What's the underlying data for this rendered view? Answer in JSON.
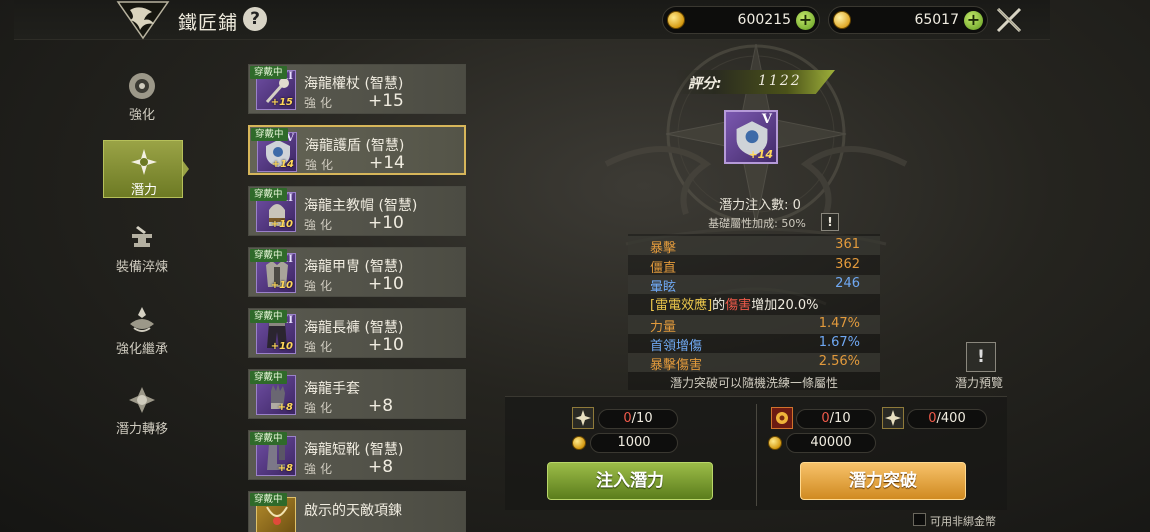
{
  "header": {
    "title": "鐵匠鋪",
    "help_label": "?",
    "currency_gold": "600215",
    "currency_diamond": "65017"
  },
  "nav": {
    "items": [
      {
        "label": "強化",
        "icon": "enhance-icon",
        "active": false
      },
      {
        "label": "潛力",
        "icon": "potential-icon",
        "active": true
      },
      {
        "label": "裝備淬煉",
        "icon": "anvil-icon",
        "active": false
      },
      {
        "label": "強化繼承",
        "icon": "inherit-icon",
        "active": false
      },
      {
        "label": "潛力轉移",
        "icon": "transfer-icon",
        "active": false
      }
    ]
  },
  "items": [
    {
      "badge": "穿戴中",
      "name": "海龍權杖 (智慧)",
      "sub": "強化",
      "value": "+15",
      "plus": "+15",
      "tier": "III"
    },
    {
      "badge": "穿戴中",
      "name": "海龍護盾 (智慧)",
      "sub": "強化",
      "value": "+14",
      "plus": "+14",
      "tier": "V"
    },
    {
      "badge": "穿戴中",
      "name": "海龍主教帽 (智慧)",
      "sub": "強化",
      "value": "+10",
      "plus": "+10",
      "tier": "III"
    },
    {
      "badge": "穿戴中",
      "name": "海龍甲冑 (智慧)",
      "sub": "強化",
      "value": "+10",
      "plus": "+10",
      "tier": "III"
    },
    {
      "badge": "穿戴中",
      "name": "海龍長褲 (智慧)",
      "sub": "強化",
      "value": "+10",
      "plus": "+10",
      "tier": "II"
    },
    {
      "badge": "穿戴中",
      "name": "海龍手套",
      "sub": "強化",
      "value": "+8",
      "plus": "+8",
      "tier": ""
    },
    {
      "badge": "穿戴中",
      "name": "海龍短靴 (智慧)",
      "sub": "強化",
      "value": "+8",
      "plus": "+8",
      "tier": ""
    },
    {
      "badge": "穿戴中",
      "name": "啟示的天敵項鍊",
      "sub": "",
      "value": "",
      "plus": "",
      "tier": ""
    }
  ],
  "detail": {
    "score_label": "評分:",
    "score_value": "1122",
    "icon_tier": "V",
    "icon_plus": "+14",
    "inject_count": "潛力注入數: 0",
    "base_bonus": "基礎屬性加成: 50%",
    "info_label": "!",
    "stats": [
      {
        "name": "暴擊",
        "value": "361"
      },
      {
        "name": "僵直",
        "value": "362"
      },
      {
        "name": "暈眩",
        "value": "246"
      }
    ],
    "special": {
      "a": "[雷電效應]",
      "b": "的",
      "c": "傷害",
      "d": "增加20.0%"
    },
    "potentials": [
      {
        "name": "力量",
        "value": "1.47%"
      },
      {
        "name": "首領增傷",
        "value": "1.67%"
      },
      {
        "name": "暴擊傷害",
        "value": "2.56%"
      }
    ],
    "note": "潛力突破可以隨機洗練一條屬性",
    "preview_label": "潛力預覽",
    "preview_icon_label": "!"
  },
  "inject": {
    "material_have": "0",
    "material_need": "/10",
    "gold_cost": "1000",
    "button": "注入潛力"
  },
  "breakthrough": {
    "material1_have": "0",
    "material1_need": "/10",
    "material2_have": "0",
    "material2_need": "/400",
    "gold_cost": "40000",
    "button": "潛力突破"
  },
  "footer": {
    "checkbox_label": "可用非綁金幣"
  },
  "colors": {
    "accent_green": "#8aa53a",
    "accent_gold": "#e6a43b",
    "stat_orange": "#e29a3c",
    "stat_blue": "#6fa8f2",
    "warning_red": "#ef5a4a",
    "equip_green": "#2f6a2a"
  }
}
